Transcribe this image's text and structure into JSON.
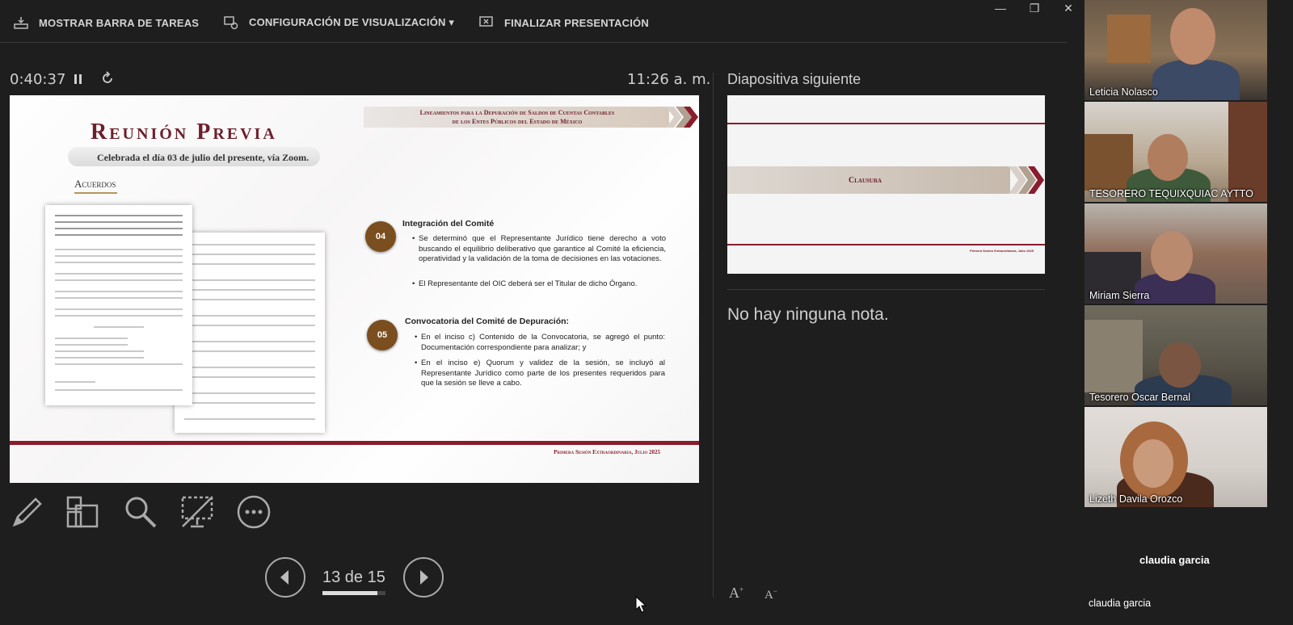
{
  "toolbar": {
    "taskbar_label": "MOSTRAR BARRA DE TAREAS",
    "display_settings_label": "CONFIGURACIÓN DE VISUALIZACIÓN ▾",
    "end_presentation_label": "FINALIZAR PRESENTACIÓN"
  },
  "window_controls": {
    "minimize": "—",
    "restore": "❐",
    "close": "✕"
  },
  "timer": {
    "elapsed": "0:40:37",
    "clock": "11:26 a. m."
  },
  "slide": {
    "title": "Reunión Previa",
    "subtitle": "Celebrada el día 03 de julio del presente, vía Zoom.",
    "section": "Acuerdos",
    "banner_line1": "Lineamientos para la Depuración de Saldos de Cuentas Contables",
    "banner_line2": "de los Entes Públicos del Estado de México",
    "items": [
      {
        "number": "04",
        "title": "Integración del Comité",
        "bullets": [
          "Se determinó que el Representante Jurídico tiene derecho a voto buscando el equilibrio deliberativo que garantice al Comité la eficiencia, operatividad y la validación de la toma de decisiones en las votaciones.",
          "El Representante del OIC deberá ser el Titular de dicho Órgano."
        ]
      },
      {
        "number": "05",
        "title": "Convocatoria del Comité de Depuración:",
        "bullets": [
          "En el inciso c) Contenido de la Convocatoria, se agregó el punto: Documentación correspondiente para analizar; y",
          "En el inciso e) Quorum y validez de la sesión, se incluyó al Representante Jurídico como parte de los presentes requeridos para que la sesión se lleve a cabo."
        ]
      }
    ],
    "footer": "Primera Sesión Extraordinaria, Julio 2025"
  },
  "navigation": {
    "page_text": "13 de 15",
    "current": 13,
    "total": 15
  },
  "next_slide": {
    "label": "Diapositiva siguiente",
    "title": "Clausura",
    "footer": "Primera Sesión Extraordinaria, Julio 2025"
  },
  "notes": {
    "text": "No hay ninguna nota."
  },
  "participants": [
    {
      "name": "Leticia Nolasco"
    },
    {
      "name": "TESORERO TEQUIXQUIAC AYTTO"
    },
    {
      "name": "Miriam Sierra"
    },
    {
      "name": "Tesorero Oscar Bernal"
    },
    {
      "name": "Lizeth Davila Orozco"
    }
  ],
  "audio_participant": {
    "display": "claudia garcia",
    "name": "claudia garcia"
  },
  "colors": {
    "maroon": "#8a1c2c",
    "badge_brown": "#7a4e1e",
    "background": "#1e1e1e"
  }
}
